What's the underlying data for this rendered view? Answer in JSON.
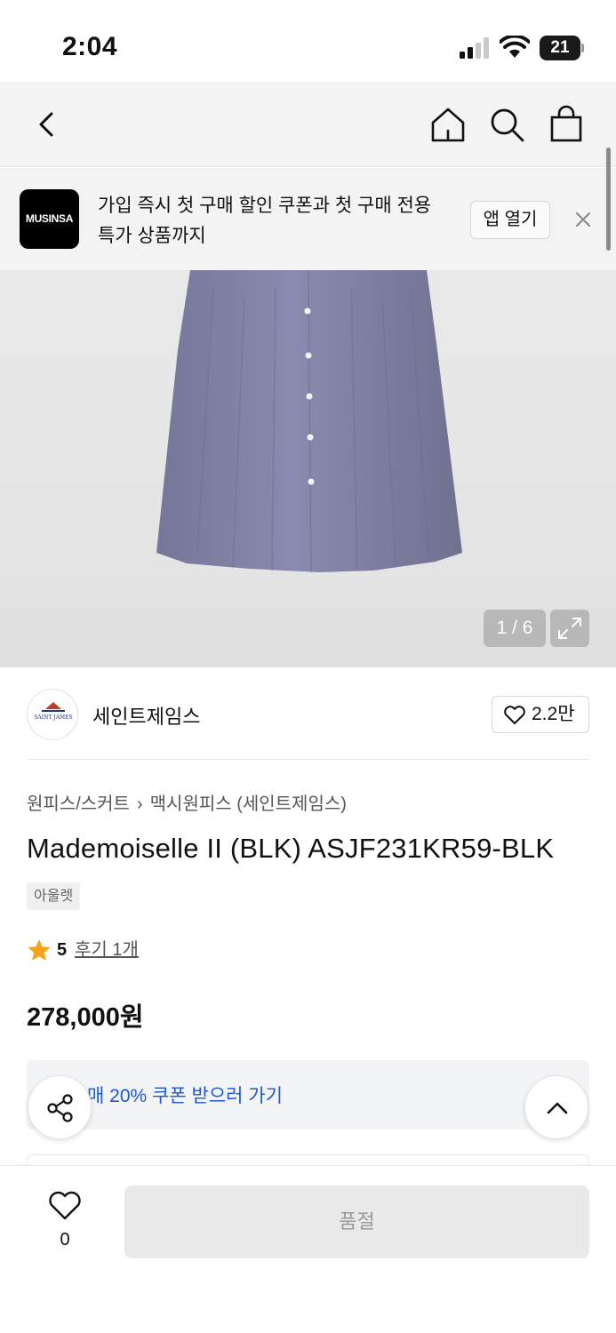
{
  "status_bar": {
    "time": "2:04",
    "battery": "21"
  },
  "nav": {
    "back_icon": "chevron-left-icon",
    "home_icon": "home-icon",
    "search_icon": "search-icon",
    "cart_icon": "shopping-bag-icon"
  },
  "banner": {
    "logo_text": "MUSINSA",
    "message": "가입 즉시 첫 구매 할인 쿠폰과 첫 구매 전용 특가 상품까지",
    "open_app_label": "앱 열기",
    "close_icon": "close-icon"
  },
  "gallery": {
    "counter": "1 / 6",
    "expand_icon": "expand-icon"
  },
  "brand": {
    "name": "세인트제임스",
    "logo_text": "SAINT JAMES",
    "likes": "2.2만"
  },
  "breadcrumb": {
    "category": "원피스/스커트",
    "subcategory": "맥시원피스 (세인트제임스)"
  },
  "product": {
    "title": "Mademoiselle II (BLK) ASJF231KR59-BLK",
    "tag": "아울렛",
    "rating": "5",
    "reviews": "후기 1개",
    "price": "278,000원"
  },
  "coupon": {
    "text": "매 20% 쿠폰 받으러 가기"
  },
  "bottom_bar": {
    "wish_count": "0",
    "buy_label": "품절"
  },
  "colors": {
    "accent_blue": "#1d56d8",
    "star": "#f7a21b",
    "dress": "#7f7fa6"
  }
}
